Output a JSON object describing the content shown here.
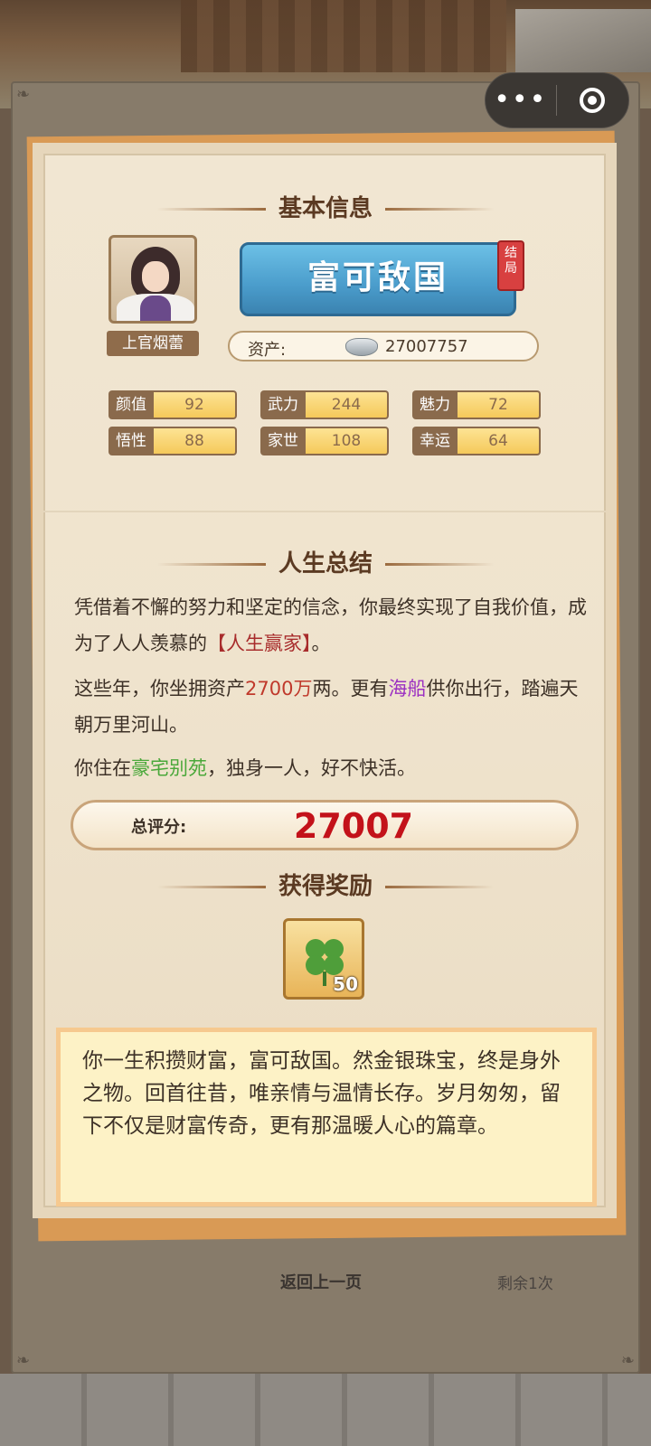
{
  "window": {
    "menu_icon": "more-dots-icon",
    "close_icon": "target-icon"
  },
  "basic_info": {
    "heading": "基本信息",
    "character_name": "上官烟蕾",
    "title": "富可敌国",
    "end_badge": "结局",
    "assets_label": "资产:",
    "assets_value": "27007757",
    "stats": [
      {
        "label": "颜值",
        "value": "92"
      },
      {
        "label": "武力",
        "value": "244"
      },
      {
        "label": "魅力",
        "value": "72"
      },
      {
        "label": "悟性",
        "value": "88"
      },
      {
        "label": "家世",
        "value": "108"
      },
      {
        "label": "幸运",
        "value": "64"
      }
    ]
  },
  "life_summary": {
    "heading": "人生总结",
    "p1_a": "凭借着不懈的努力和坚定的信念，你最终实现了自我价值，成为了人人羡慕的",
    "p1_highlight": "【人生赢家】",
    "p1_b": "。",
    "p2_a": "这些年，你坐拥资产",
    "p2_amount": "2700万",
    "p2_b": "两。更有",
    "p2_vehicle": "海船",
    "p2_c": "供你出行，踏遍天朝万里河山。",
    "p3_a": "你住在",
    "p3_house": "豪宅别苑",
    "p3_b": "，独身一人，好不快活。"
  },
  "score": {
    "label": "总评分:",
    "value": "27007"
  },
  "rewards": {
    "heading": "获得奖励",
    "items": [
      {
        "icon": "clover-icon",
        "count": "50"
      }
    ]
  },
  "epilogue": "你一生积攒财富，富可敌国。然金银珠宝，终是身外之物。回首往昔，唯亲情与温情长存。岁月匆匆，留下不仅是财富传奇，更有那温暖人心的篇章。",
  "footer": {
    "back": "返回上一页",
    "remaining": "剩余1次"
  }
}
